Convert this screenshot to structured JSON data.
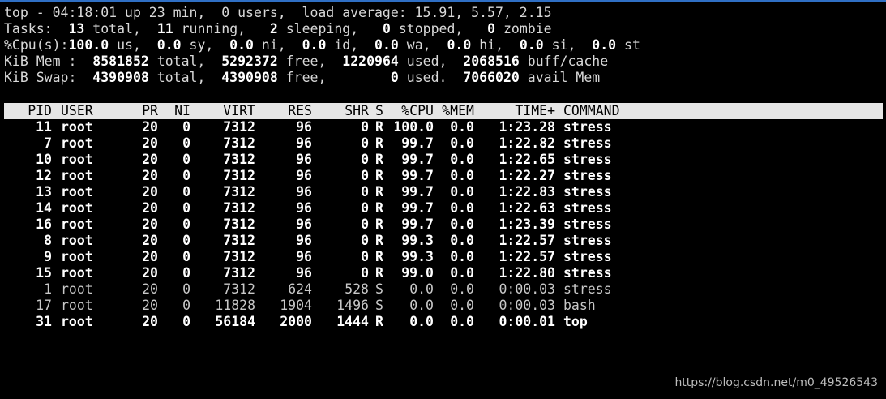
{
  "colors": {
    "background": "#000000",
    "text": "#d8d8d8",
    "bold_text": "#ffffff",
    "header_bg": "#e6e6e6",
    "header_text": "#000000",
    "top_rule": "#2f6fc4"
  },
  "summary": {
    "uptime": {
      "t1": "top - 04:18:01 up 23 min,  0 users,  load average: 15.91, 5.57, 2.15"
    },
    "tasks": {
      "t1": "Tasks: ",
      "v1": " 13",
      "t2": " total, ",
      "v2": " 11",
      "t3": " running, ",
      "v3": "  2",
      "t4": " sleeping, ",
      "v4": "  0",
      "t5": " stopped, ",
      "v5": "  0",
      "t6": " zombie"
    },
    "cpu": {
      "t1": "%Cpu(s):",
      "v1": "100.0",
      "t2": " us, ",
      "v2": " 0.0",
      "t3": " sy, ",
      "v3": " 0.0",
      "t4": " ni, ",
      "v4": " 0.0",
      "t5": " id, ",
      "v5": " 0.0",
      "t6": " wa, ",
      "v6": " 0.0",
      "t7": " hi, ",
      "v7": " 0.0",
      "t8": " si, ",
      "v8": " 0.0",
      "t9": " st"
    },
    "mem": {
      "t1": "KiB Mem : ",
      "v1": " 8581852",
      "t2": " total, ",
      "v2": " 5292372",
      "t3": " free, ",
      "v3": " 1220964",
      "t4": " used, ",
      "v4": " 2068516",
      "t5": " buff/cache"
    },
    "swap": {
      "t1": "KiB Swap: ",
      "v1": " 4390908",
      "t2": " total, ",
      "v2": " 4390908",
      "t3": " free, ",
      "v3": "       0",
      "t4": " used. ",
      "v4": " 7066020",
      "t5": " avail Mem"
    }
  },
  "columns": {
    "pid": "PID",
    "user": "USER",
    "pr": "PR",
    "ni": "NI",
    "virt": "VIRT",
    "res": "RES",
    "shr": "SHR",
    "s": "S",
    "cpu": "%CPU",
    "mem": "%MEM",
    "time": "TIME+",
    "command": "COMMAND"
  },
  "processes": [
    {
      "pid": "11",
      "user": "root",
      "pr": "20",
      "ni": "0",
      "virt": "7312",
      "res": "96",
      "shr": "0",
      "s": "R",
      "cpu": "100.0",
      "mem": "0.0",
      "time": "1:23.28",
      "command": "stress"
    },
    {
      "pid": "7",
      "user": "root",
      "pr": "20",
      "ni": "0",
      "virt": "7312",
      "res": "96",
      "shr": "0",
      "s": "R",
      "cpu": "99.7",
      "mem": "0.0",
      "time": "1:22.82",
      "command": "stress"
    },
    {
      "pid": "10",
      "user": "root",
      "pr": "20",
      "ni": "0",
      "virt": "7312",
      "res": "96",
      "shr": "0",
      "s": "R",
      "cpu": "99.7",
      "mem": "0.0",
      "time": "1:22.65",
      "command": "stress"
    },
    {
      "pid": "12",
      "user": "root",
      "pr": "20",
      "ni": "0",
      "virt": "7312",
      "res": "96",
      "shr": "0",
      "s": "R",
      "cpu": "99.7",
      "mem": "0.0",
      "time": "1:22.27",
      "command": "stress"
    },
    {
      "pid": "13",
      "user": "root",
      "pr": "20",
      "ni": "0",
      "virt": "7312",
      "res": "96",
      "shr": "0",
      "s": "R",
      "cpu": "99.7",
      "mem": "0.0",
      "time": "1:22.83",
      "command": "stress"
    },
    {
      "pid": "14",
      "user": "root",
      "pr": "20",
      "ni": "0",
      "virt": "7312",
      "res": "96",
      "shr": "0",
      "s": "R",
      "cpu": "99.7",
      "mem": "0.0",
      "time": "1:22.63",
      "command": "stress"
    },
    {
      "pid": "16",
      "user": "root",
      "pr": "20",
      "ni": "0",
      "virt": "7312",
      "res": "96",
      "shr": "0",
      "s": "R",
      "cpu": "99.7",
      "mem": "0.0",
      "time": "1:23.39",
      "command": "stress"
    },
    {
      "pid": "8",
      "user": "root",
      "pr": "20",
      "ni": "0",
      "virt": "7312",
      "res": "96",
      "shr": "0",
      "s": "R",
      "cpu": "99.3",
      "mem": "0.0",
      "time": "1:22.57",
      "command": "stress"
    },
    {
      "pid": "9",
      "user": "root",
      "pr": "20",
      "ni": "0",
      "virt": "7312",
      "res": "96",
      "shr": "0",
      "s": "R",
      "cpu": "99.3",
      "mem": "0.0",
      "time": "1:22.57",
      "command": "stress"
    },
    {
      "pid": "15",
      "user": "root",
      "pr": "20",
      "ni": "0",
      "virt": "7312",
      "res": "96",
      "shr": "0",
      "s": "R",
      "cpu": "99.0",
      "mem": "0.0",
      "time": "1:22.80",
      "command": "stress"
    },
    {
      "pid": "1",
      "user": "root",
      "pr": "20",
      "ni": "0",
      "virt": "7312",
      "res": "624",
      "shr": "528",
      "s": "S",
      "cpu": "0.0",
      "mem": "0.0",
      "time": "0:00.03",
      "command": "stress"
    },
    {
      "pid": "17",
      "user": "root",
      "pr": "20",
      "ni": "0",
      "virt": "11828",
      "res": "1904",
      "shr": "1496",
      "s": "S",
      "cpu": "0.0",
      "mem": "0.0",
      "time": "0:00.03",
      "command": "bash"
    },
    {
      "pid": "31",
      "user": "root",
      "pr": "20",
      "ni": "0",
      "virt": "56184",
      "res": "2000",
      "shr": "1444",
      "s": "R",
      "cpu": "0.0",
      "mem": "0.0",
      "time": "0:00.01",
      "command": "top"
    }
  ],
  "watermark": "https://blog.csdn.net/m0_49526543"
}
